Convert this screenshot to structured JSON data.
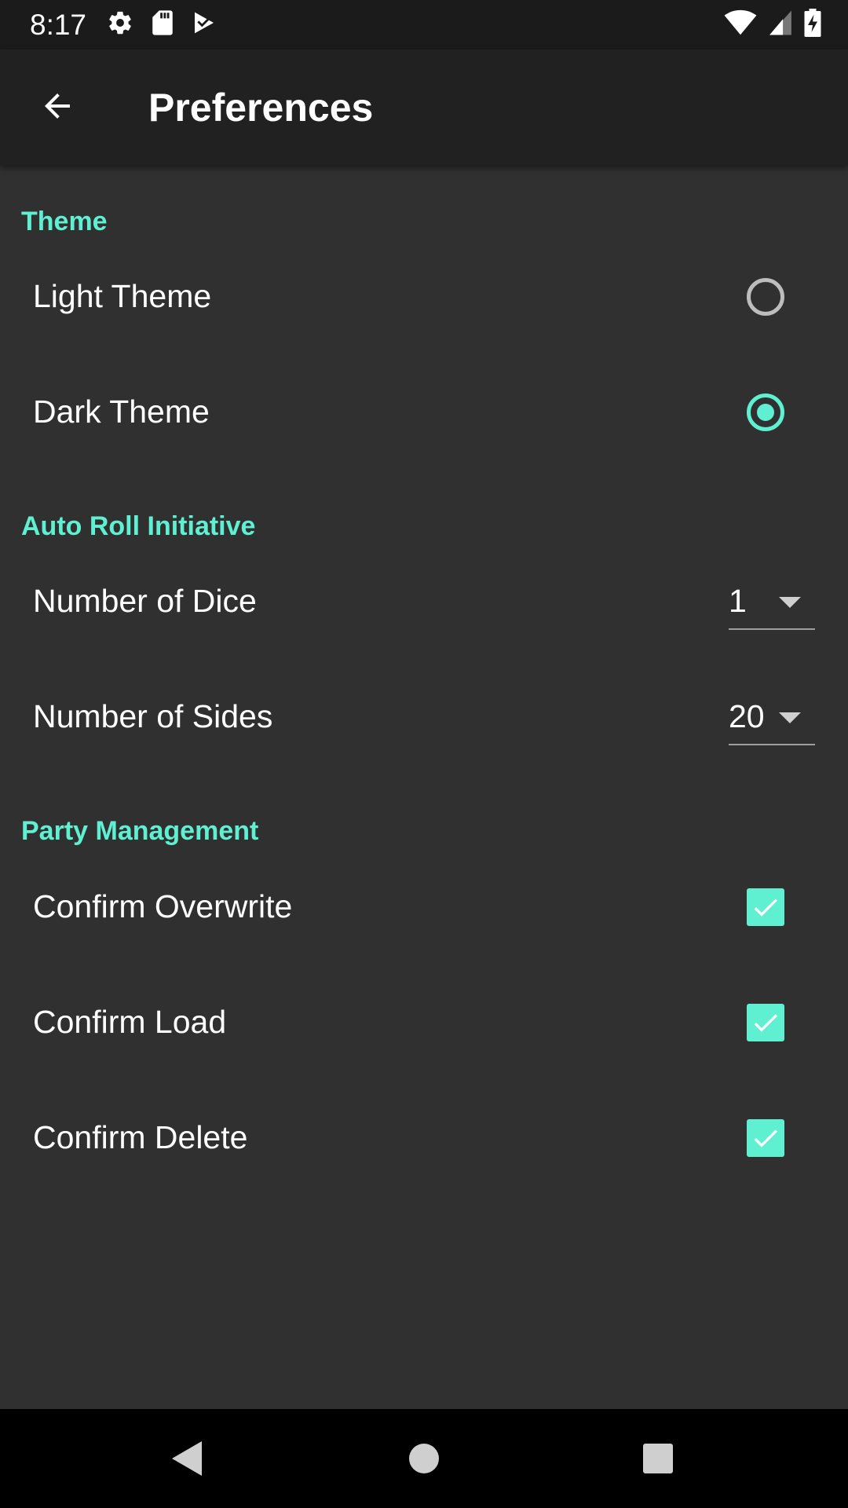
{
  "status_bar": {
    "time": "8:17",
    "left_icons": [
      "gear-icon",
      "sd-card-icon",
      "play-store-icon"
    ],
    "right_icons": [
      "wifi-icon",
      "cell-signal-icon",
      "battery-charging-icon"
    ]
  },
  "app_bar": {
    "title": "Preferences",
    "back_icon": "arrow-left-icon"
  },
  "sections": [
    {
      "header": "Theme",
      "items": [
        {
          "label": "Light Theme",
          "control": "radio",
          "checked": false
        },
        {
          "label": "Dark Theme",
          "control": "radio",
          "checked": true
        }
      ]
    },
    {
      "header": "Auto Roll Initiative",
      "items": [
        {
          "label": "Number of Dice",
          "control": "dropdown",
          "value": "1"
        },
        {
          "label": "Number of Sides",
          "control": "dropdown",
          "value": "20"
        }
      ]
    },
    {
      "header": "Party Management",
      "items": [
        {
          "label": "Confirm Overwrite",
          "control": "checkbox",
          "checked": true
        },
        {
          "label": "Confirm Load",
          "control": "checkbox",
          "checked": true
        },
        {
          "label": "Confirm Delete",
          "control": "checkbox",
          "checked": true
        }
      ]
    }
  ],
  "nav_bar": {
    "buttons": [
      "back-triangle-icon",
      "home-circle-icon",
      "recents-square-icon"
    ]
  },
  "colors": {
    "accent": "#5ff0d2",
    "background": "#303030",
    "app_bar": "#212121",
    "status_bar": "#1b1b1b",
    "nav_bar": "#000000"
  }
}
